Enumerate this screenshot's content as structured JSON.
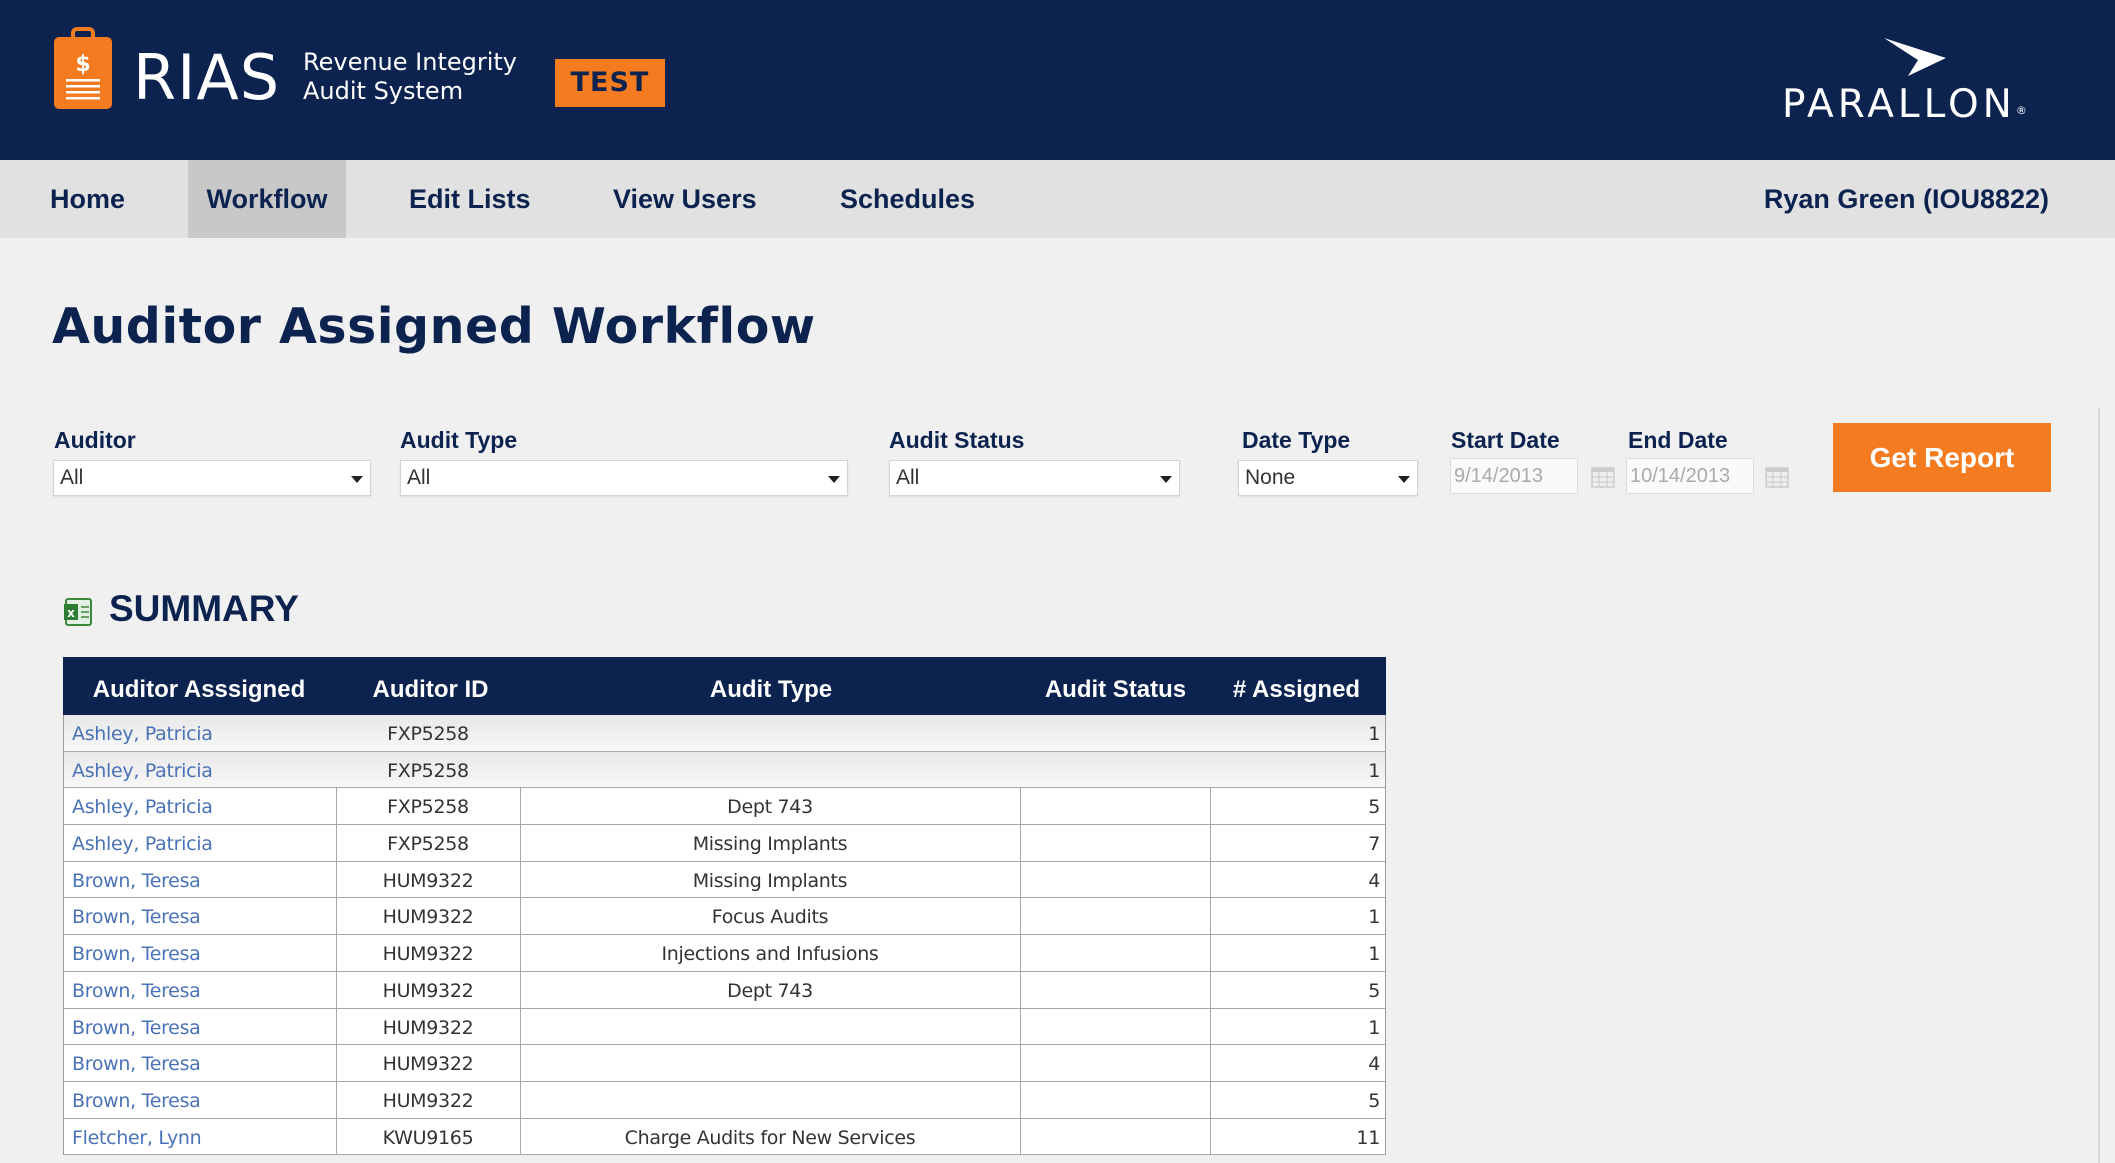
{
  "header": {
    "brand": "RIAS",
    "subtitle_line1": "Revenue Integrity",
    "subtitle_line2": "Audit System",
    "env_badge": "TEST",
    "company": "PARALLON",
    "company_mark": "®"
  },
  "nav": {
    "items": [
      {
        "label": "Home"
      },
      {
        "label": "Workflow",
        "active": true
      },
      {
        "label": "Edit Lists"
      },
      {
        "label": "View Users"
      },
      {
        "label": "Schedules"
      }
    ],
    "user": "Ryan Green (IOU8822)"
  },
  "page_title": "Auditor Assigned Workflow",
  "filters": {
    "auditor": {
      "label": "Auditor",
      "value": "All"
    },
    "audit_type": {
      "label": "Audit Type",
      "value": "All"
    },
    "audit_status": {
      "label": "Audit Status",
      "value": "All"
    },
    "date_type": {
      "label": "Date Type",
      "value": "None"
    },
    "start_date": {
      "label": "Start Date",
      "value": "9/14/2013"
    },
    "end_date": {
      "label": "End Date",
      "value": "10/14/2013"
    },
    "submit_label": "Get Report"
  },
  "summary": {
    "title": "SUMMARY",
    "export_icon": "excel-icon",
    "columns": [
      "Auditor Asssigned",
      "Auditor ID",
      "Audit Type",
      "Audit Status",
      "# Assigned"
    ],
    "rows": [
      {
        "auditor": "Ashley, Patricia",
        "id": "FXP5258",
        "type": "",
        "status": "",
        "assigned": "1"
      },
      {
        "auditor": "Ashley, Patricia",
        "id": "FXP5258",
        "type": "",
        "status": "",
        "assigned": "1"
      },
      {
        "auditor": "Ashley, Patricia",
        "id": "FXP5258",
        "type": "Dept 743",
        "status": "",
        "assigned": "5"
      },
      {
        "auditor": "Ashley, Patricia",
        "id": "FXP5258",
        "type": "Missing Implants",
        "status": "",
        "assigned": "7"
      },
      {
        "auditor": "Brown, Teresa",
        "id": "HUM9322",
        "type": "Missing Implants",
        "status": "",
        "assigned": "4"
      },
      {
        "auditor": "Brown, Teresa",
        "id": "HUM9322",
        "type": "Focus Audits",
        "status": "",
        "assigned": "1"
      },
      {
        "auditor": "Brown, Teresa",
        "id": "HUM9322",
        "type": "Injections and Infusions",
        "status": "",
        "assigned": "1"
      },
      {
        "auditor": "Brown, Teresa",
        "id": "HUM9322",
        "type": "Dept 743",
        "status": "",
        "assigned": "5"
      },
      {
        "auditor": "Brown, Teresa",
        "id": "HUM9322",
        "type": "",
        "status": "",
        "assigned": "1"
      },
      {
        "auditor": "Brown, Teresa",
        "id": "HUM9322",
        "type": "",
        "status": "",
        "assigned": "4"
      },
      {
        "auditor": "Brown, Teresa",
        "id": "HUM9322",
        "type": "",
        "status": "",
        "assigned": "5"
      },
      {
        "auditor": "Fletcher, Lynn",
        "id": "KWU9165",
        "type": "Charge Audits for New Services",
        "status": "",
        "assigned": "11"
      }
    ]
  },
  "colors": {
    "navy": "#0c2350",
    "orange": "#f47b20",
    "link_blue": "#4a72b8"
  }
}
